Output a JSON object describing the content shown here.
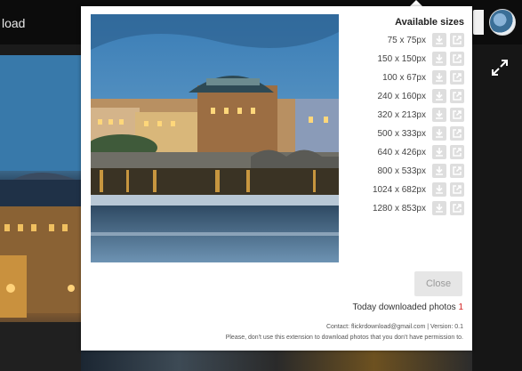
{
  "background": {
    "page_title": "load"
  },
  "popup": {
    "sizes_title": "Available sizes",
    "sizes": [
      {
        "label": "75 x 75px"
      },
      {
        "label": "150 x 150px"
      },
      {
        "label": "100 x 67px"
      },
      {
        "label": "240 x 160px"
      },
      {
        "label": "320 x 213px"
      },
      {
        "label": "500 x 333px"
      },
      {
        "label": "640 x 426px"
      },
      {
        "label": "800 x 533px"
      },
      {
        "label": "1024 x 682px"
      },
      {
        "label": "1280 x 853px"
      }
    ],
    "close_label": "Close",
    "today_label": "Today downloaded photos",
    "today_count": "1",
    "contact_text": "Contact: flickrdownload@gmail.com | Version: 0.1",
    "disclaimer_text": "Please, don't use this extension to download photos that you don't have permission to."
  },
  "colors": {
    "count_accent": "#d21f1f",
    "button_gray": "#dedede"
  },
  "icons": {
    "download": "download-icon",
    "open": "open-in-new-icon",
    "expand": "fullscreen-icon"
  }
}
